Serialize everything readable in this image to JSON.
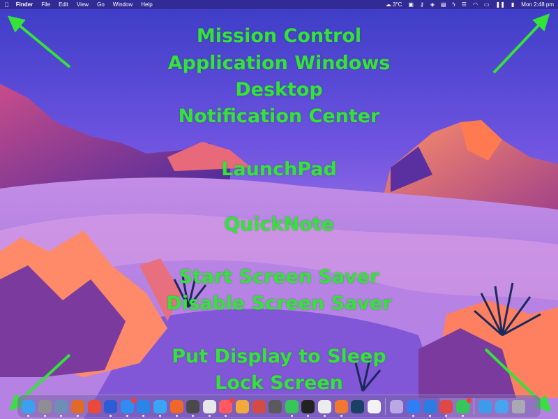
{
  "menubar": {
    "apple_icon": "apple-icon",
    "app_name": "Finder",
    "items": [
      "File",
      "Edit",
      "View",
      "Go",
      "Window",
      "Help"
    ],
    "weather": "3°C",
    "clock": "Mon 2:48 pm",
    "status_icons": [
      "bag-icon",
      "key-icon",
      "shield-icon",
      "clipboard-icon",
      "bolt-icon",
      "toggle-icon",
      "wifi-icon",
      "display-icon",
      "pause-icon",
      "battery-icon"
    ]
  },
  "overlay": {
    "labels": [
      "Mission Control",
      "Application Windows",
      "Desktop",
      "Notification Center",
      "LaunchPad",
      "QuickNote",
      "Start Screen Saver",
      "Disable Screen Saver",
      "Put Display to Sleep",
      "Lock Screen"
    ],
    "color": "#34e33a"
  },
  "dock": {
    "apps": [
      {
        "name": "finder",
        "color": "#3aa0f0"
      },
      {
        "name": "launchpad",
        "color": "#8e8e93"
      },
      {
        "name": "preview",
        "color": "#6d8fb5"
      },
      {
        "name": "firefox-nightly",
        "color": "#e06a2a"
      },
      {
        "name": "calendar",
        "color": "#e94a3c"
      },
      {
        "name": "reminders",
        "color": "#2c5cd6"
      },
      {
        "name": "mail",
        "color": "#2f8cf0"
      },
      {
        "name": "messages-alt",
        "color": "#2a86e6"
      },
      {
        "name": "safari",
        "color": "#38a6f5"
      },
      {
        "name": "firefox",
        "color": "#f0662b"
      },
      {
        "name": "photo-cloud",
        "color": "#4a4a4a"
      },
      {
        "name": "slack",
        "color": "#e8e8e8"
      },
      {
        "name": "craft",
        "color": "#ff5a5f"
      },
      {
        "name": "tes",
        "color": "#f2a93b"
      },
      {
        "name": "bear",
        "color": "#d44b45"
      },
      {
        "name": "lens",
        "color": "#5a5a5a"
      },
      {
        "name": "messages",
        "color": "#35c759"
      },
      {
        "name": "terminal",
        "color": "#222222"
      },
      {
        "name": "chatgpt",
        "color": "#ececec"
      },
      {
        "name": "burst",
        "color": "#f27830"
      },
      {
        "name": "xcode-like",
        "color": "#1c3f66"
      },
      {
        "name": "openai",
        "color": "#f2f2f2"
      },
      {
        "name": "stack",
        "color": "#b9a7e6"
      },
      {
        "name": "app-store",
        "color": "#2f7ef5"
      },
      {
        "name": "bird",
        "color": "#2a7de1"
      },
      {
        "name": "grid",
        "color": "#e04848"
      },
      {
        "name": "facetime",
        "color": "#35c759"
      },
      {
        "name": "folder-blue",
        "color": "#3d9be9"
      },
      {
        "name": "downloads",
        "color": "#4aa3ef"
      },
      {
        "name": "trash",
        "color": "#a9a9b4"
      }
    ]
  }
}
